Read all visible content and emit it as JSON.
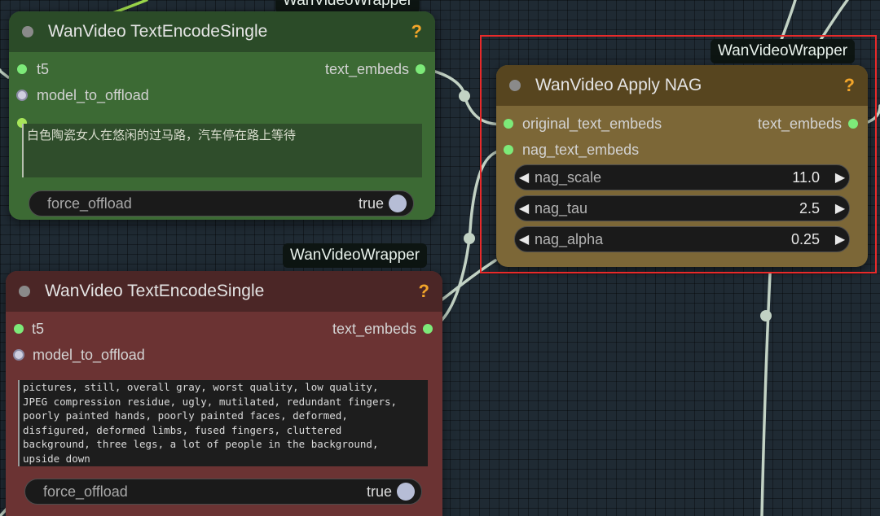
{
  "canvas": {
    "badges": {
      "top_clipped": "WanVideoWrapper",
      "middle": "WanVideoWrapper",
      "right": "WanVideoWrapper"
    }
  },
  "node_positive": {
    "title": "WanVideo TextEncodeSingle",
    "help": "?",
    "input_t5": "t5",
    "output": "text_embeds",
    "input_offload": "model_to_offload",
    "prompt": "白色陶瓷女人在悠闲的过马路，汽车停在路上等待",
    "toggle_label": "force_offload",
    "toggle_value": "true",
    "color": "#3c6a34"
  },
  "node_negative": {
    "title": "WanVideo TextEncodeSingle",
    "help": "?",
    "input_t5": "t5",
    "output": "text_embeds",
    "input_offload": "model_to_offload",
    "prompt": "pictures, still, overall gray, worst quality, low quality,\nJPEG compression residue, ugly, mutilated, redundant fingers,\npoorly painted hands, poorly painted faces, deformed,\ndisfigured, deformed limbs, fused fingers, cluttered\nbackground, three legs, a lot of people in the background,\nupside down",
    "toggle_label": "force_offload",
    "toggle_value": "true",
    "color": "#6b3333"
  },
  "node_nag": {
    "title": "WanVideo Apply NAG",
    "help": "?",
    "input_original": "original_text_embeds",
    "output": "text_embeds",
    "input_nag": "nag_text_embeds",
    "widgets": {
      "scale": {
        "label": "nag_scale",
        "value": "11.0"
      },
      "tau": {
        "label": "nag_tau",
        "value": "2.5"
      },
      "alpha": {
        "label": "nag_alpha",
        "value": "0.25"
      }
    },
    "color": "#7c6737",
    "selection_color": "#e82a2a"
  }
}
